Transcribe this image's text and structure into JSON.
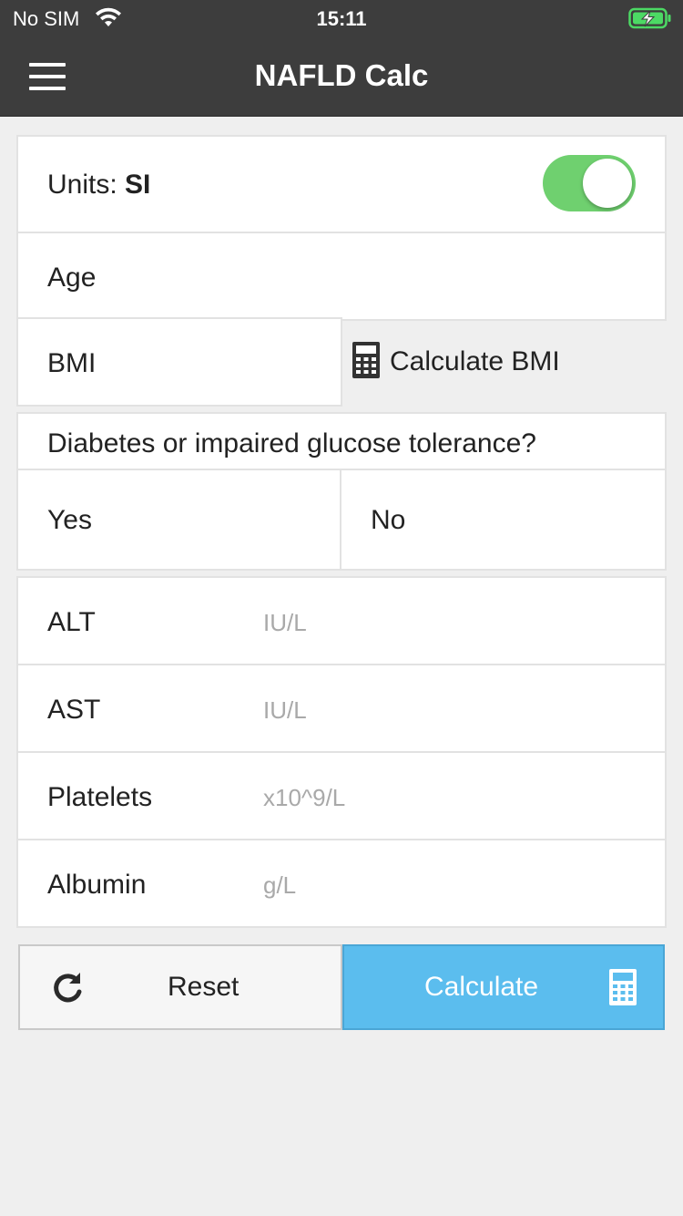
{
  "status_bar": {
    "carrier": "No SIM",
    "time": "15:11",
    "wifi_icon": "wifi-icon",
    "battery_icon": "battery-charging-icon",
    "battery_color": "#4cd964"
  },
  "nav": {
    "title": "NAFLD Calc",
    "menu_icon": "hamburger-menu-icon",
    "background_color": "#3d3d3d"
  },
  "units": {
    "label_prefix": "Units: ",
    "value": "SI",
    "toggle_on": true,
    "toggle_color": "#6fd06f"
  },
  "age": {
    "label": "Age",
    "value": ""
  },
  "bmi": {
    "label": "BMI",
    "value": "",
    "calc_link": "Calculate BMI",
    "calc_icon": "calculator-icon"
  },
  "diabetes": {
    "question": "Diabetes or impaired glucose tolerance?",
    "options": [
      "Yes",
      "No"
    ]
  },
  "labs": [
    {
      "label": "ALT",
      "unit": "IU/L"
    },
    {
      "label": "AST",
      "unit": "IU/L"
    },
    {
      "label": "Platelets",
      "unit": "x10^9/L"
    },
    {
      "label": "Albumin",
      "unit": "g/L"
    }
  ],
  "actions": {
    "reset_label": "Reset",
    "reset_icon": "refresh-icon",
    "calculate_label": "Calculate",
    "calculate_icon": "calculator-icon",
    "calculate_color": "#5bbdee"
  }
}
